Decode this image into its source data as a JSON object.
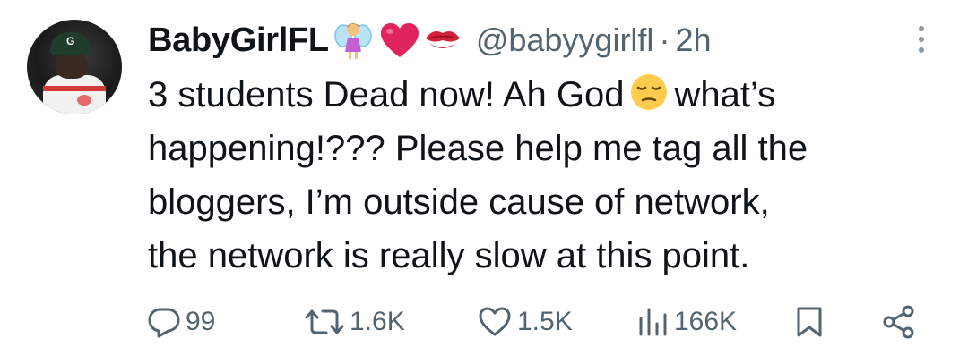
{
  "tweet": {
    "author_name": "BabyGirlFL",
    "author_emojis": [
      "fairy-emoji",
      "red-heart-emoji",
      "kiss-mark-emoji"
    ],
    "handle": "@babyygirlfl",
    "separator": "·",
    "time": "2h",
    "lines": [
      "3 students Dead now! Ah God",
      "what’s",
      "happening!??? Please help me tag all the",
      "bloggers, I’m outside cause of network,",
      "the network is really slow at this point."
    ],
    "inline_emoji": "pensive-face-emoji"
  },
  "actions": {
    "reply_count": "99",
    "retweet_count": "1.6K",
    "like_count": "1.5K",
    "views_count": "166K"
  },
  "colors": {
    "text": "#0f1419",
    "secondary": "#536471",
    "background": "#ffffff",
    "heart": "#e0245e"
  }
}
